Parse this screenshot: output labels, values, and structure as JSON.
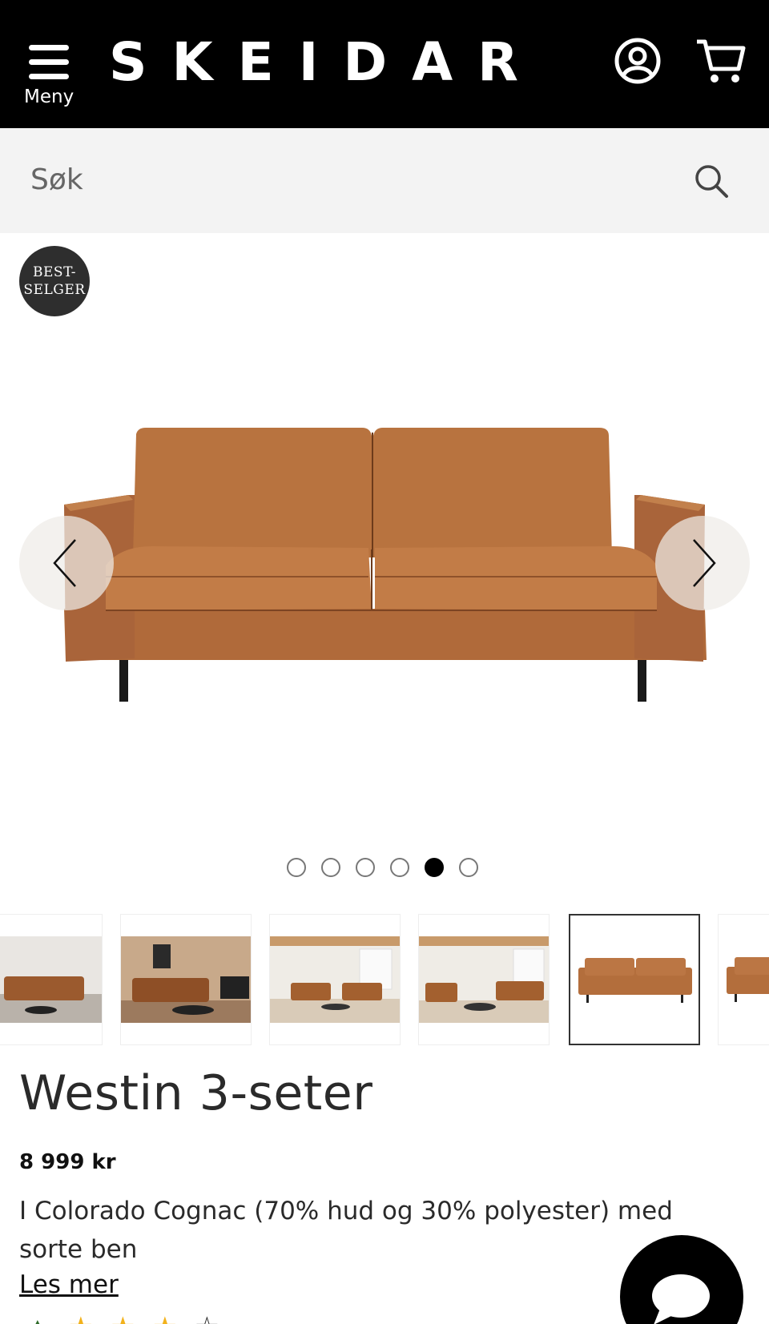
{
  "header": {
    "logo": "SKEIDAR",
    "menu_label": "Meny",
    "account_icon": "user-circle-icon",
    "cart_icon": "shopping-cart-icon"
  },
  "search": {
    "placeholder": "Søk",
    "icon": "search-icon"
  },
  "gallery": {
    "badge": [
      "BEST-",
      "SELGER"
    ],
    "image_count": 6,
    "active_index": 4,
    "prev_icon": "chevron-left-icon",
    "next_icon": "chevron-right-icon"
  },
  "product": {
    "title": "Westin 3-seter",
    "price": "8 999 kr",
    "description": "I Colorado Cognac (70% hud og 30% polyester) med sorte ben",
    "read_more": "Les mer"
  },
  "colors": {
    "header_bg": "#000000",
    "search_bg": "#f3f3f3",
    "sofa": "#b6713f",
    "badge_bg": "#2e2e2e"
  },
  "chat": {
    "icon": "chat-bubble-icon"
  }
}
